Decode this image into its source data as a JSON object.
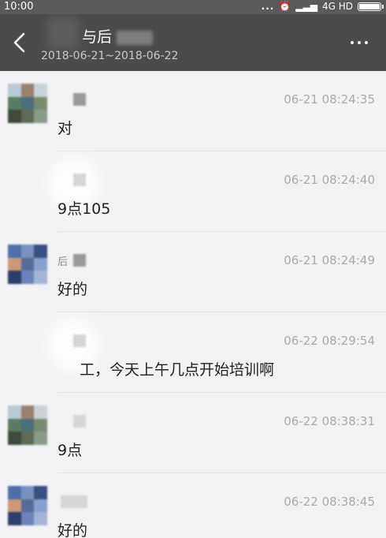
{
  "status_bar": {
    "time": "10:00",
    "dots": "...",
    "network": "4G HD"
  },
  "header": {
    "title_prefix": "与后",
    "date_range": "2018-06-21~2018-06-22"
  },
  "messages": [
    {
      "time": "06-21 08:24:35",
      "text": "对"
    },
    {
      "time": "06-21 08:24:40",
      "text": "9点105"
    },
    {
      "time": "06-21 08:24:49",
      "text": "好的",
      "sender_fragment": "后"
    },
    {
      "time": "06-22 08:29:54",
      "text": "工，今天上午几点开始培训啊"
    },
    {
      "time": "06-22 08:38:31",
      "text": "9点"
    },
    {
      "time": "06-22 08:38:45",
      "text": "好的"
    }
  ]
}
